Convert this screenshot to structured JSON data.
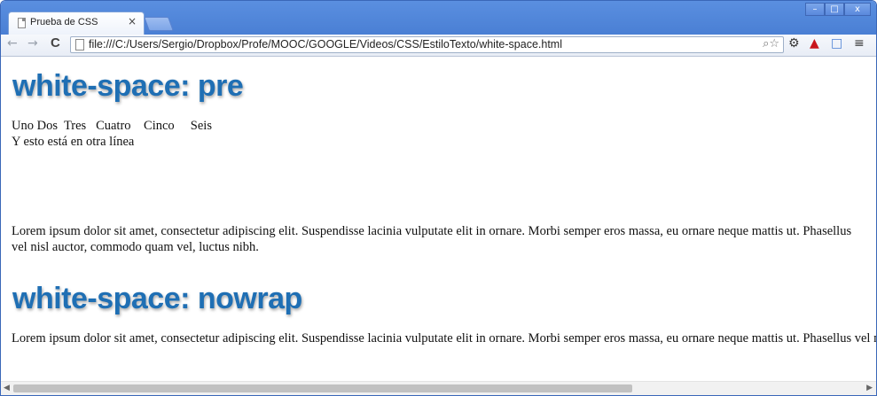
{
  "browser": {
    "tab_title": "Prueba de CSS",
    "tab_close": "×",
    "url": "file:///C:/Users/Sergio/Dropbox/Profe/MOOC/GOOGLE/Videos/CSS/EstiloTexto/white-space.html",
    "window_buttons": {
      "minimize": "–",
      "maximize": "□",
      "close": "x"
    },
    "nav": {
      "back": "←",
      "forward": "→",
      "reload": "C"
    },
    "toolbar_icons": [
      "zoom-icon",
      "star-icon",
      "gear-icon",
      "extension-icon",
      "fullscreen-icon",
      "menu-icon"
    ],
    "colors": {
      "title_bar": "#4a7fd4",
      "heading": "#1f6fb4"
    }
  },
  "page": {
    "heading_pre": "white-space: pre",
    "pre_line1": "Uno Dos  Tres   Cuatro    Cinco     Seis",
    "pre_line2": "Y esto está en otra línea",
    "lorem_paragraph": "Lorem ipsum dolor sit amet, consectetur adipiscing elit. Suspendisse lacinia vulputate elit in ornare. Morbi semper eros massa, eu ornare neque mattis ut. Phasellus vel nisl auctor, commodo quam vel, luctus nibh.",
    "heading_nowrap": "white-space: nowrap",
    "nowrap_paragraph": "Lorem ipsum dolor sit amet, consectetur adipiscing elit. Suspendisse lacinia vulputate elit in ornare. Morbi semper eros massa, eu ornare neque mattis ut. Phasellus vel nisl auctor, commodo quam vel, luctus nibh."
  }
}
